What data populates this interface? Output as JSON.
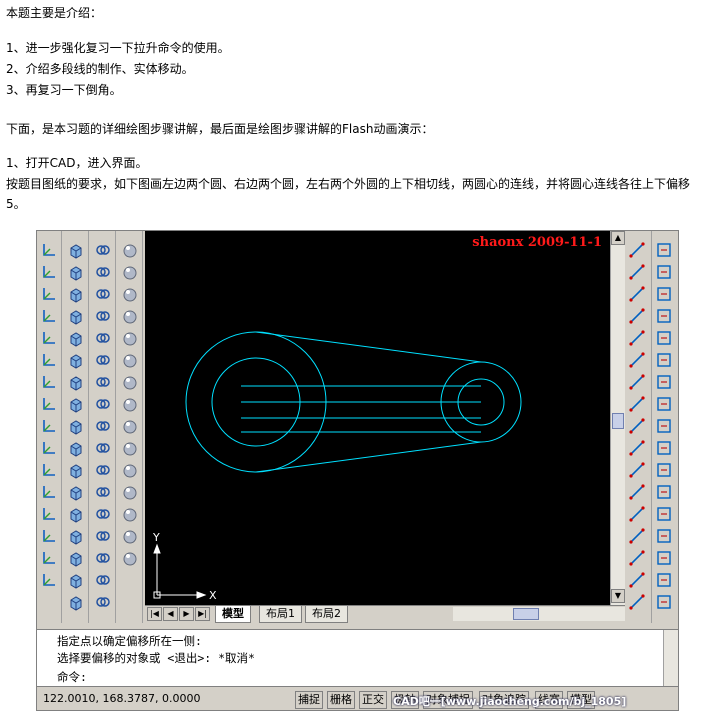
{
  "article": {
    "intro": "本题主要是介绍：",
    "points": [
      "1、进一步强化复习一下拉升命令的使用。",
      "2、介绍多段线的制作、实体移动。",
      "3、再复习一下倒角。"
    ],
    "below": "下面，是本习题的详细绘图步骤讲解，最后面是绘图步骤讲解的Flash动画演示：",
    "step1_title": "1、打开CAD，进入界面。",
    "step1_body": "按题目图纸的要求，如下图画左边两个圆、右边两个圆，左右两个外圆的上下相切线，两圆心的连线，并将圆心连线各往上下偏移5。"
  },
  "cad": {
    "watermark": "shaonx 2009-11-1",
    "ucs_y": "Y",
    "ucs_x": "X",
    "tabs": [
      "模型",
      "布局1",
      "布局2"
    ],
    "command_lines": [
      "指定点以确定偏移所在一侧:",
      "选择要偏移的对象或 <退出>: *取消*",
      "命令:"
    ],
    "coordinates": "122.0010, 168.3787, 0.0000",
    "status_buttons": [
      "捕捉",
      "栅格",
      "正交",
      "极轴",
      "对象捕捉",
      "对象追踪",
      "线宽",
      "模型"
    ],
    "credit": "CAD吧一[www.jiaocheng.com/bj_1805]",
    "colors": {
      "canvas": "#000000",
      "lines": "#00e0ff",
      "watermark": "#ff1a1a",
      "chrome": "#d4d0c8"
    }
  }
}
